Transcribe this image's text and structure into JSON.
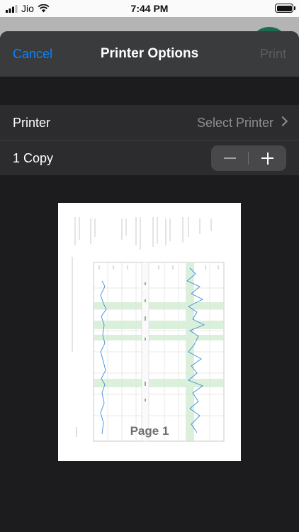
{
  "status_bar": {
    "carrier": "Jio",
    "time": "7:44 PM"
  },
  "nav": {
    "cancel": "Cancel",
    "title": "Printer Options",
    "print": "Print"
  },
  "printer_row": {
    "label": "Printer",
    "value": "Select Printer"
  },
  "copies_row": {
    "label": "1 Copy"
  },
  "preview": {
    "page_label": "Page 1"
  },
  "colors": {
    "accent": "#0a84ff",
    "sheet_bg": "#1c1c1e",
    "row_bg": "#2c2c2e",
    "nav_bg": "#3a3b3d"
  },
  "icons": [
    "signal-icon",
    "wifi-icon",
    "battery-icon",
    "chevron-right-icon",
    "minus-icon",
    "plus-icon"
  ]
}
